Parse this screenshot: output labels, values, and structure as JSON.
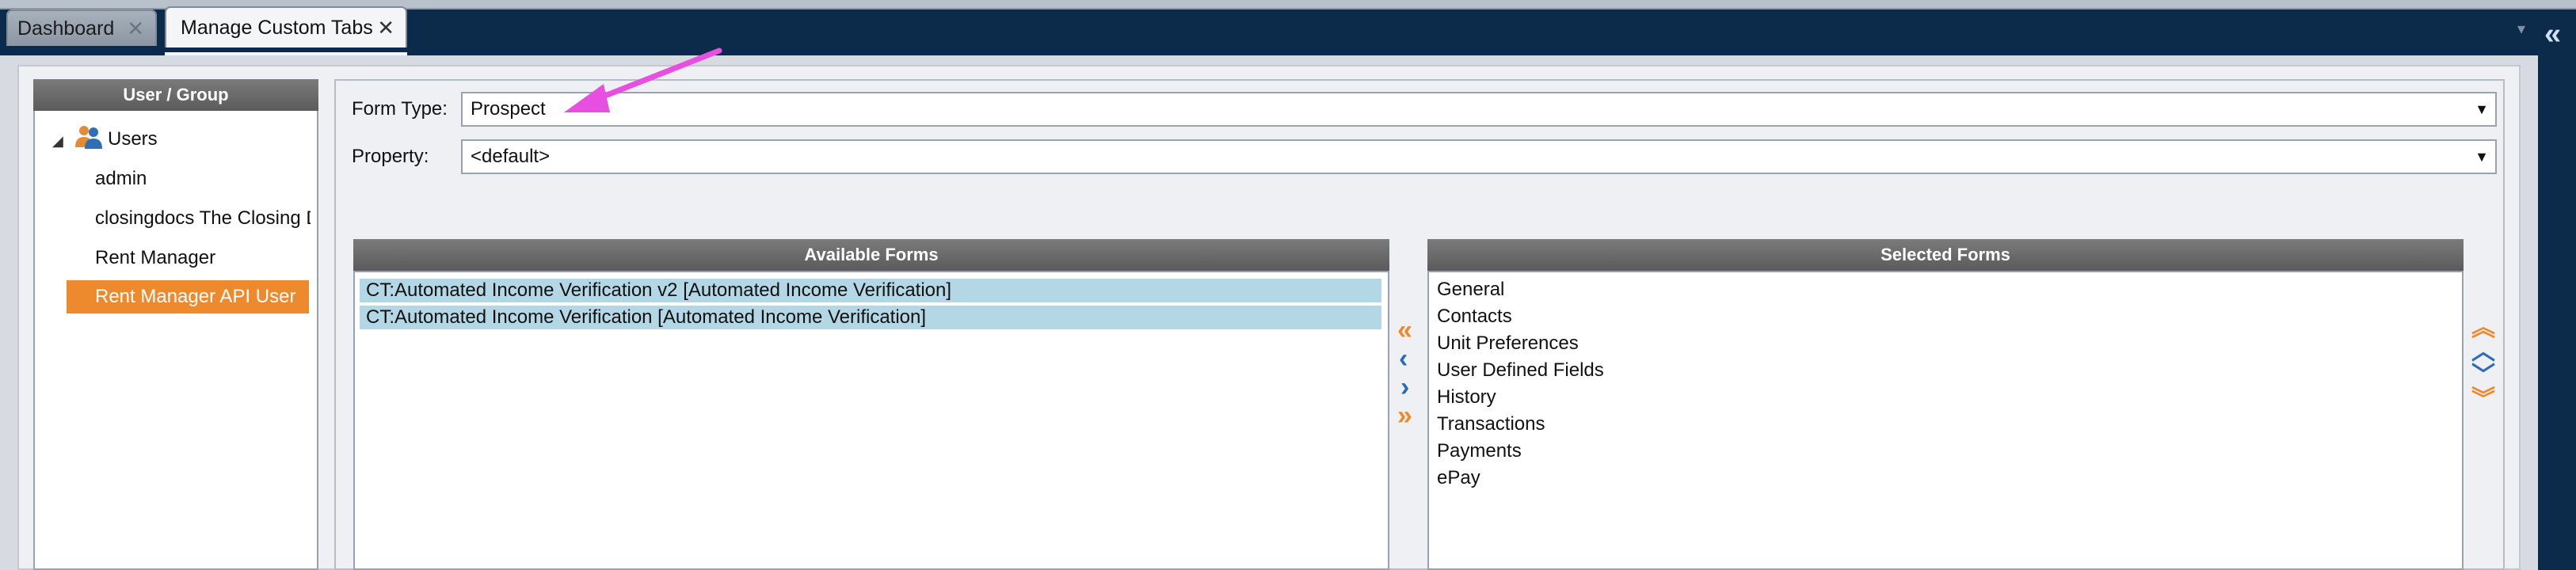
{
  "tabs": [
    {
      "label": "Dashboard",
      "close": "✕"
    },
    {
      "label": "Manage Custom Tabs",
      "close": "✕"
    }
  ],
  "icons": {
    "close": "close-icon",
    "collapse": "double-chevron-left-icon",
    "panel_dropdown": "chevron-down-icon",
    "tree_toggle": "triangle-down-icon",
    "users": "users-icon"
  },
  "left_panel": {
    "title": "User / Group",
    "root": "Users",
    "items": [
      "admin",
      "closingdocs The Closing D",
      "Rent Manager",
      "Rent Manager API User"
    ],
    "selected_index": 3
  },
  "form": {
    "form_type_label": "Form Type:",
    "form_type_value": "Prospect",
    "property_label": "Property:",
    "property_value": "<default>"
  },
  "available_forms": {
    "title": "Available Forms",
    "items": [
      "CT:Automated Income Verification v2 [Automated Income Verification]",
      "CT:Automated Income Verification [Automated Income Verification]"
    ]
  },
  "selected_forms": {
    "title": "Selected Forms",
    "items": [
      "General",
      "Contacts",
      "Unit Preferences",
      "User Defined Fields",
      "History",
      "Transactions",
      "Payments",
      "ePay"
    ]
  },
  "colors": {
    "tabbar": "#0c2a4a",
    "selected_item": "#ee8a2e",
    "list_highlight": "#b4d7e6",
    "annotation_arrow": "#e64fe0",
    "move_blue": "#2b6cb7",
    "move_orange": "#ee8a2e"
  }
}
